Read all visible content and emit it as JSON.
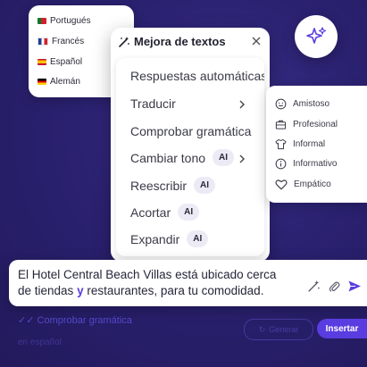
{
  "languages": [
    {
      "label": "Portugués",
      "flag": "pt"
    },
    {
      "label": "Francés",
      "flag": "fr"
    },
    {
      "label": "Español",
      "flag": "es"
    },
    {
      "label": "Alemán",
      "flag": "de"
    }
  ],
  "menu": {
    "title": "Mejora de textos",
    "items": [
      {
        "label": "Respuestas automáticas",
        "badge": "",
        "chevron": false
      },
      {
        "label": "Traducir",
        "badge": "",
        "chevron": true
      },
      {
        "label": "Comprobar gramática",
        "badge": "",
        "chevron": false
      },
      {
        "label": "Cambiar tono",
        "badge": "AI",
        "chevron": true
      },
      {
        "label": "Reescribir",
        "badge": "AI",
        "chevron": false
      },
      {
        "label": "Acortar",
        "badge": "AI",
        "chevron": false
      },
      {
        "label": "Expandir",
        "badge": "AI",
        "chevron": false
      }
    ]
  },
  "tones": [
    {
      "label": "Amistoso",
      "icon": "smiley-icon"
    },
    {
      "label": "Profesional",
      "icon": "briefcase-icon"
    },
    {
      "label": "Informal",
      "icon": "shirt-icon"
    },
    {
      "label": "Informativo",
      "icon": "info-icon"
    },
    {
      "label": "Empático",
      "icon": "heart-icon"
    }
  ],
  "editor": {
    "line1": "El Hotel Central Beach Villas está ubicado cerca",
    "line2_before": "de tiendas ",
    "line2_highlight": "y",
    "line2_after": " restaurantes, para tu comodidad."
  },
  "bottom": {
    "grammar_link": "Comprobar gramática",
    "faded_line": "en español",
    "generate_label": "Generar",
    "insert_label": "Insertar"
  },
  "colors": {
    "background": "#2b2270",
    "accent": "#5a3de0"
  }
}
